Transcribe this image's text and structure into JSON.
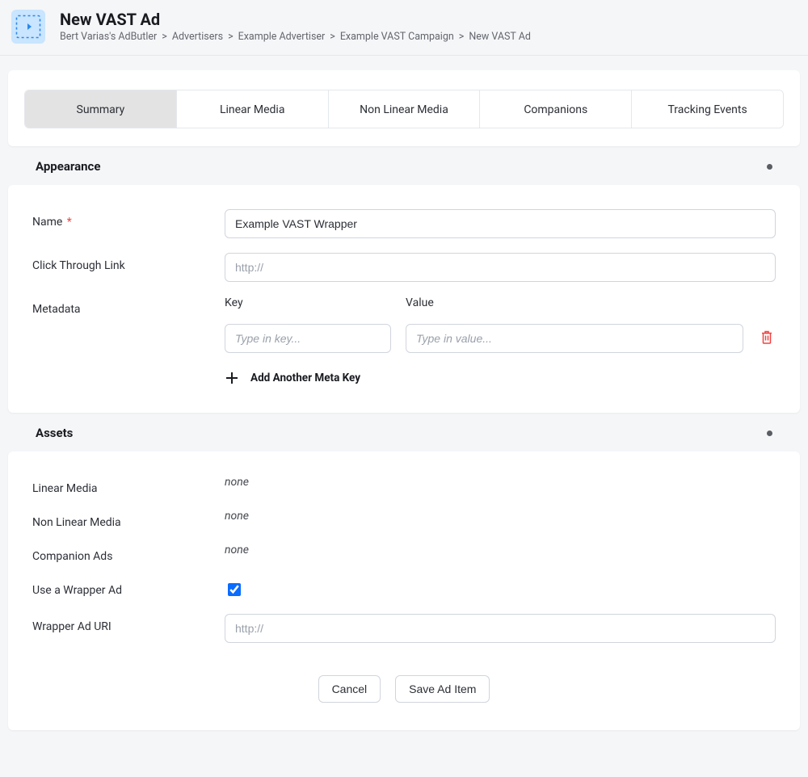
{
  "header": {
    "title": "New VAST Ad",
    "breadcrumb": [
      "Bert Varias's AdButler",
      "Advertisers",
      "Example Advertiser",
      "Example VAST Campaign",
      "New VAST Ad"
    ]
  },
  "tabs": [
    {
      "label": "Summary",
      "active": true
    },
    {
      "label": "Linear Media",
      "active": false
    },
    {
      "label": "Non Linear Media",
      "active": false
    },
    {
      "label": "Companions",
      "active": false
    },
    {
      "label": "Tracking Events",
      "active": false
    }
  ],
  "sections": {
    "appearance": {
      "title": "Appearance",
      "name_label": "Name",
      "name_value": "Example VAST Wrapper",
      "click_label": "Click Through Link",
      "click_placeholder": "http://",
      "metadata_label": "Metadata",
      "meta_key_header": "Key",
      "meta_value_header": "Value",
      "meta_key_placeholder": "Type in key...",
      "meta_value_placeholder": "Type in value...",
      "add_meta_label": "Add Another Meta Key"
    },
    "assets": {
      "title": "Assets",
      "rows": {
        "linear": {
          "label": "Linear Media",
          "value": "none"
        },
        "nonlinear": {
          "label": "Non Linear Media",
          "value": "none"
        },
        "companion": {
          "label": "Companion Ads",
          "value": "none"
        },
        "wrapper_chk": {
          "label": "Use a Wrapper Ad",
          "checked": true
        },
        "wrapper_uri": {
          "label": "Wrapper Ad URI",
          "placeholder": "http://"
        }
      }
    }
  },
  "buttons": {
    "cancel": "Cancel",
    "save": "Save Ad Item"
  }
}
